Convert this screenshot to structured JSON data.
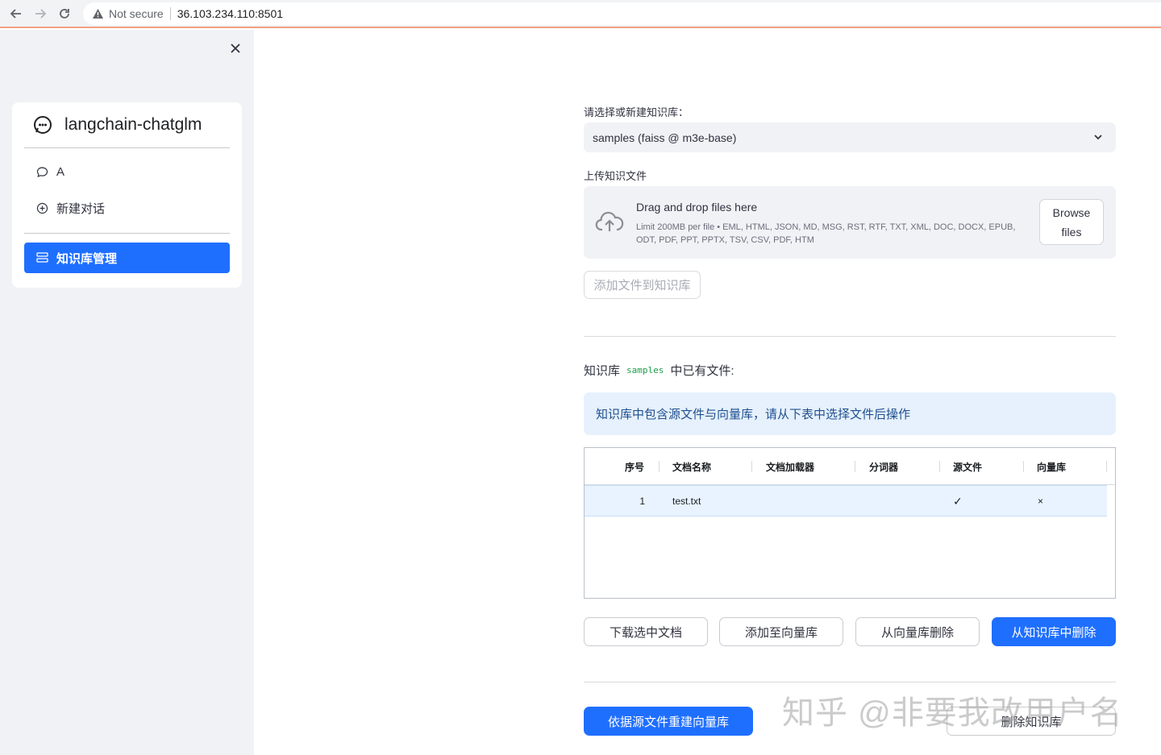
{
  "browser": {
    "security_label": "Not secure",
    "url": "36.103.234.110:8501"
  },
  "sidebar": {
    "app_title": "langchain-chatglm",
    "items": [
      {
        "label": "A",
        "icon": "chat-bubble-icon"
      },
      {
        "label": "新建对话",
        "icon": "plus-circle-icon"
      }
    ],
    "active_item": {
      "label": "知识库管理",
      "icon": "database-icon"
    }
  },
  "main": {
    "kb_select_label": "请选择或新建知识库：",
    "kb_select_value": "samples (faiss @ m3e-base)",
    "upload_label": "上传知识文件",
    "dropzone": {
      "title": "Drag and drop files here",
      "limit": "Limit 200MB per file • EML, HTML, JSON, MD, MSG, RST, RTF, TXT, XML, DOC, DOCX, EPUB, ODT, PDF, PPT, PPTX, TSV, CSV, PDF, HTM",
      "browse_line1": "Browse",
      "browse_line2": "files"
    },
    "add_files_button": "添加文件到知识库",
    "kb_heading_prefix": "知识库",
    "kb_heading_name": "samples",
    "kb_heading_suffix": "中已有文件:",
    "info_text": "知识库中包含源文件与向量库，请从下表中选择文件后操作",
    "table": {
      "columns": [
        "序号",
        "文档名称",
        "文档加载器",
        "分词器",
        "源文件",
        "向量库"
      ],
      "rows": [
        {
          "index": "1",
          "name": "test.txt",
          "loader": "",
          "splitter": "",
          "source": "✓",
          "vector": "×"
        }
      ]
    },
    "actions": {
      "download": "下载选中文档",
      "add_to_vector": "添加至向量库",
      "delete_from_vector": "从向量库删除",
      "delete_from_kb": "从知识库中删除"
    },
    "rebuild_button": "依据源文件重建向量库",
    "delete_kb_button": "删除知识库"
  },
  "watermark": "知乎 @非要我改用户名",
  "colors": {
    "primary": "#1f6fff",
    "sidebar_bg": "#f0f2f6",
    "info_bg": "#e6f1fd"
  }
}
